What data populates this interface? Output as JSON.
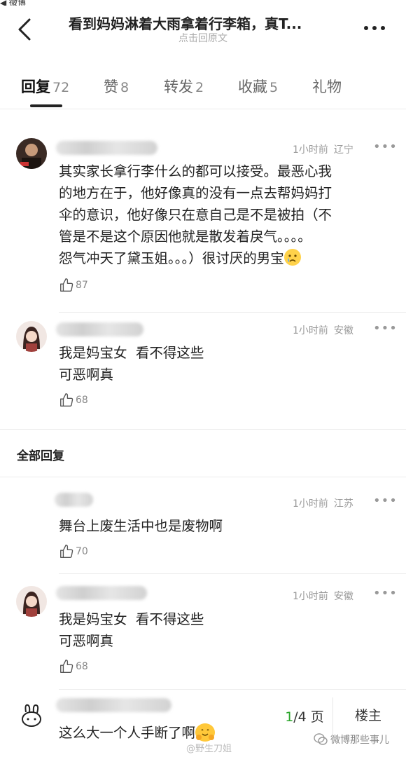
{
  "status_bar": {
    "back_text": "◀ 微博"
  },
  "header": {
    "title": "看到妈妈淋着大雨拿着行李箱，真T...",
    "subtitle": "点击回原文"
  },
  "tabs": [
    {
      "label": "回复",
      "count": "72",
      "active": true
    },
    {
      "label": "赞",
      "count": "8",
      "active": false
    },
    {
      "label": "转发",
      "count": "2",
      "active": false
    },
    {
      "label": "收藏",
      "count": "5",
      "active": false
    },
    {
      "label": "礼物",
      "count": "",
      "active": false
    }
  ],
  "comments": [
    {
      "time": "1小时前",
      "location": "辽宁",
      "text": "其实家长拿行李什么的都可以接受。最恶心我\n的地方在于，他好像真的没有一点去帮妈妈打\n伞的意识，他好像只在意自己是不是被拍（不\n管是不是这个原因他就是散发着戾气。。。。\n怨气冲天了黛玉姐。。。）很讨厌的男宝",
      "likes": "87",
      "emoji": "crying-face"
    },
    {
      "time": "1小时前",
      "location": "安徽",
      "text": "我是妈宝女  看不得这些\n可恶啊真",
      "likes": "68"
    }
  ],
  "all_replies_title": "全部回复",
  "all_replies": [
    {
      "time": "1小时前",
      "location": "江苏",
      "text": "舞台上废生活中也是废物啊",
      "likes": "70"
    },
    {
      "time": "1小时前",
      "location": "安徽",
      "text": "我是妈宝女  看不得这些\n可恶啊真",
      "likes": "68"
    },
    {
      "text": "这么大一个人手断了啊",
      "emoji": "hugging-face"
    }
  ],
  "bottom_bar": {
    "page_current": "1",
    "page_total": "/4 页",
    "floor_label": "楼主"
  },
  "watermarks": {
    "center": "@野生刀姐",
    "right": "微博那些事儿"
  },
  "colors": {
    "accent_green": "#2aa52a",
    "text_primary": "#222222",
    "text_meta": "#999999"
  }
}
